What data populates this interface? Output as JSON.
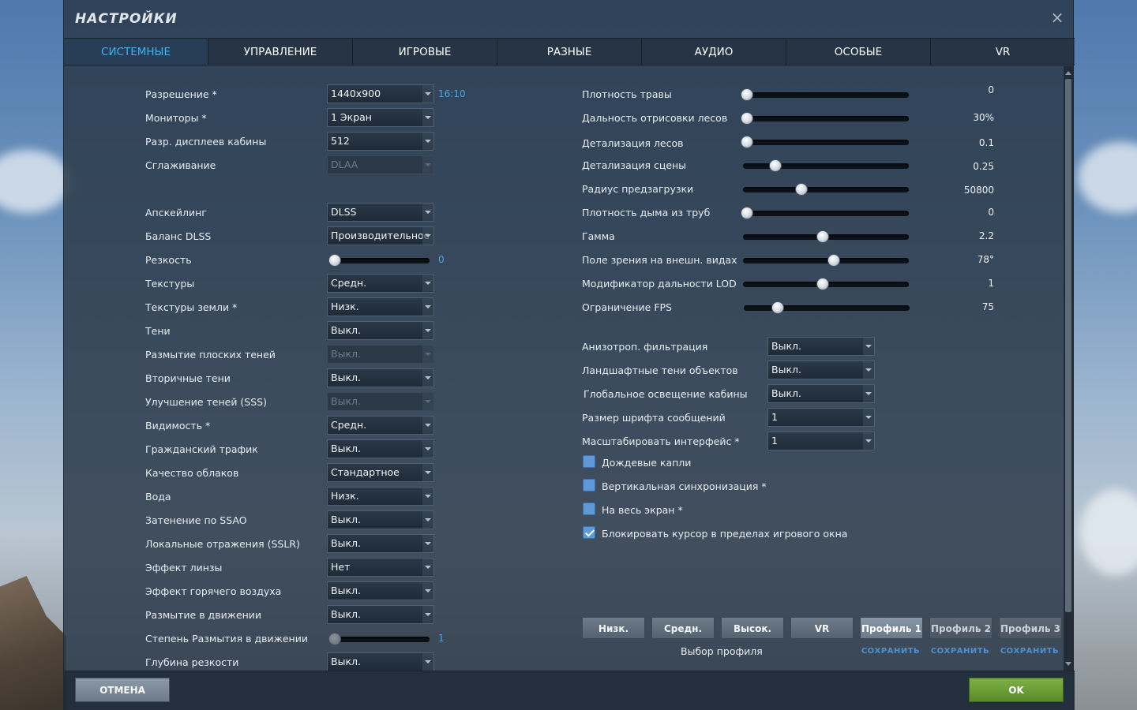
{
  "window": {
    "title": "НАСТРОЙКИ",
    "close_icon": "close-icon"
  },
  "tabs": [
    {
      "label": "СИСТЕМНЫЕ",
      "active": true
    },
    {
      "label": "УПРАВЛЕНИЕ",
      "active": false
    },
    {
      "label": "ИГРОВЫЕ",
      "active": false
    },
    {
      "label": "РАЗНЫЕ",
      "active": false
    },
    {
      "label": "АУДИО",
      "active": false
    },
    {
      "label": "ОСОБЫЕ",
      "active": false
    },
    {
      "label": "VR",
      "active": false
    }
  ],
  "left": {
    "resolution": {
      "label": "Разрешение *",
      "value": "1440x900",
      "aspect": "16:10"
    },
    "monitors": {
      "label": "Мониторы *",
      "value": "1 Экран"
    },
    "cockpit_res": {
      "label": "Разр. дисплеев кабины",
      "value": "512"
    },
    "antialiasing": {
      "label": "Сглаживание",
      "value": "DLAA"
    },
    "upscaling": {
      "label": "Апскейлинг",
      "value": "DLSS"
    },
    "dlss_balance": {
      "label": "Баланс DLSS",
      "value": "Производительнос"
    },
    "sharpness": {
      "label": "Резкость",
      "value": "0",
      "fraction": 0.0
    },
    "textures": {
      "label": "Текстуры",
      "value": "Средн."
    },
    "terrain_textures": {
      "label": "Текстуры земли *",
      "value": "Низк."
    },
    "shadows": {
      "label": "Тени",
      "value": "Выкл."
    },
    "flat_shadow_blur": {
      "label": "Размытие плоских теней",
      "value": "Выкл."
    },
    "secondary_shadows": {
      "label": "Вторичные тени",
      "value": "Выкл."
    },
    "sss": {
      "label": "Улучшение теней (SSS)",
      "value": "Выкл."
    },
    "visibility": {
      "label": "Видимость *",
      "value": "Средн."
    },
    "civil_traffic": {
      "label": "Гражданский трафик",
      "value": "Выкл."
    },
    "clouds": {
      "label": "Качество облаков",
      "value": "Стандартное"
    },
    "water": {
      "label": "Вода",
      "value": "Низк."
    },
    "ssao": {
      "label": "Затенение по SSAO",
      "value": "Выкл."
    },
    "sslr": {
      "label": "Локальные отражения (SSLR)",
      "value": "Выкл."
    },
    "lens": {
      "label": "Эффект линзы",
      "value": "Нет"
    },
    "heat_blur": {
      "label": "Эффект горячего воздуха",
      "value": "Выкл."
    },
    "motion_blur": {
      "label": "Размытие в движении",
      "value": "Выкл."
    },
    "motion_blur_amount": {
      "label": "Степень Размытия в движении",
      "value": "1",
      "fraction": 0.0
    },
    "dof": {
      "label": "Глубина резкости",
      "value": "Выкл."
    }
  },
  "right": {
    "sliders": [
      {
        "label": "Плотность травы",
        "value": "0",
        "fraction": 0.0
      },
      {
        "label": "Дальность отрисовки лесов",
        "value": "30%",
        "fraction": 0.0
      },
      {
        "label": "Детализация лесов",
        "value": "0.1",
        "fraction": 0.0
      },
      {
        "label": "Детализация сцены",
        "value": "0.25",
        "fraction": 0.17
      },
      {
        "label": "Радиус предзагрузки",
        "value": "50800",
        "fraction": 0.34
      },
      {
        "label": "Плотность дыма из труб",
        "value": "0",
        "fraction": 0.0
      },
      {
        "label": "Гамма",
        "value": "2.2",
        "fraction": 0.48
      },
      {
        "label": "Поле зрения на внешн. видах",
        "value": "78°",
        "fraction": 0.55
      },
      {
        "label": "Модификатор дальности LOD",
        "value": "1",
        "fraction": 0.48
      },
      {
        "label": "Ограничение FPS",
        "value": "75",
        "fraction": 0.18
      }
    ],
    "dropdowns": [
      {
        "label": "Анизотроп. фильтрация",
        "value": "Выкл."
      },
      {
        "label": "Ландшафтные тени объектов",
        "value": "Выкл."
      },
      {
        "label": "Глобальное освещение кабины",
        "value": "Выкл."
      },
      {
        "label": "Размер шрифта сообщений",
        "value": "1"
      },
      {
        "label": "Масштабировать интерфейс *",
        "value": "1"
      }
    ],
    "checkboxes": [
      {
        "label": "Дождевые капли",
        "checked": false
      },
      {
        "label": "Вертикальная синхронизация *",
        "checked": false
      },
      {
        "label": "На весь экран *",
        "checked": false
      },
      {
        "label": "Блокировать курсор в пределах игрового окна",
        "checked": true
      }
    ]
  },
  "presets": {
    "buttons": [
      {
        "label": "Низк."
      },
      {
        "label": "Средн."
      },
      {
        "label": "Высок."
      },
      {
        "label": "VR"
      },
      {
        "label": "Профиль 1",
        "save": "СОХРАНИТЬ"
      },
      {
        "label": "Профиль 2",
        "save": "СОХРАНИТЬ"
      },
      {
        "label": "Профиль 3",
        "save": "СОХРАНИТЬ"
      }
    ],
    "caption": "Выбор профиля"
  },
  "footer": {
    "cancel_label": "ОТМЕНА",
    "ok_label": "OK"
  }
}
